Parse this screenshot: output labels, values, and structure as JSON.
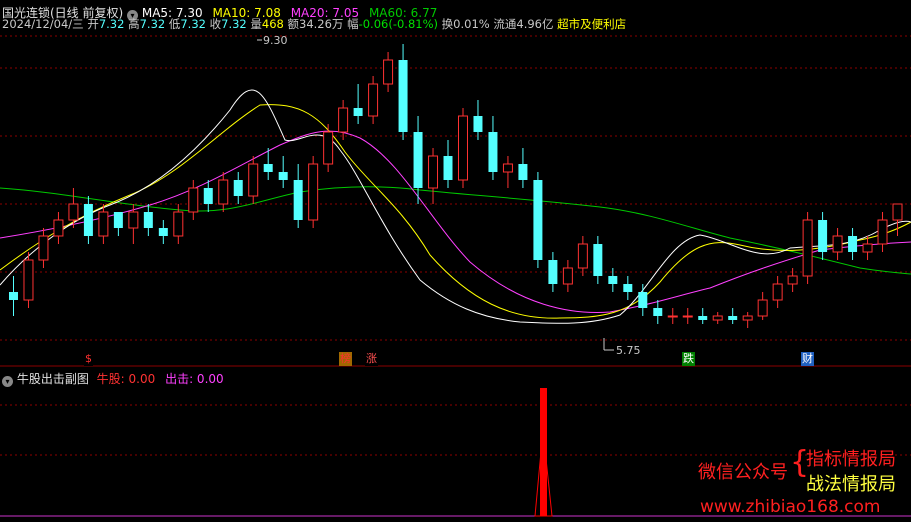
{
  "colors": {
    "up": "#ff3232",
    "down": "#54ffff",
    "ma5": "#ffffff",
    "ma10": "#ffff00",
    "ma20": "#ff40ff",
    "ma60": "#00c800",
    "grid": "#8b0000",
    "text": "#c8c8c8",
    "watermark": "#ff2020"
  },
  "header": {
    "title": "国光连锁(日线 前复权)",
    "ma5": "MA5: 7.30",
    "ma10": "MA10: 7.08",
    "ma20": "MA20: 7.05",
    "ma60": "MA60: 6.77"
  },
  "info": {
    "date": "2024/12/04/三",
    "open_label": "开",
    "open": "7.32",
    "high_label": "高",
    "high": "7.32",
    "low_label": "低",
    "low": "7.32",
    "close_label": "收",
    "close": "7.32",
    "vol_label": "量",
    "vol": "468",
    "amt_label": "额",
    "amt": "34.26万",
    "chg_label": "幅",
    "chg": "-0.06(-0.81%)",
    "turnover": "换0.01%",
    "float": "流通4.96亿",
    "sector": "超市及便利店"
  },
  "annotations": {
    "high_price": "9.30",
    "low_price": "5.75"
  },
  "event_tags": [
    {
      "label": "$",
      "color": "#ff3030",
      "bg": "#000"
    },
    {
      "label": "榜",
      "color": "#ff3030",
      "bg": "#a06800"
    },
    {
      "label": "涨",
      "color": "#ff5050",
      "bg": "#000"
    },
    {
      "label": "跌",
      "color": "#ffffff",
      "bg": "#008000"
    },
    {
      "label": "财",
      "color": "#ffffff",
      "bg": "#2060c0"
    }
  ],
  "sub": {
    "title": "牛股出击副图",
    "label1": "牛股: 0.00",
    "label2": "出击: 0.00"
  },
  "watermark": {
    "line1": "微信公众号",
    "line2a": "指标情报局",
    "line2b": "战法情报局",
    "url": "www.zhibiao168.com"
  },
  "chart_data": {
    "type": "candlestick",
    "y_high_marker": 9.3,
    "y_low_marker": 5.75,
    "last": {
      "open": 7.32,
      "high": 7.32,
      "low": 7.32,
      "close": 7.32,
      "volume": 468
    },
    "ma": {
      "MA5": 7.3,
      "MA10": 7.08,
      "MA20": 7.05,
      "MA60": 6.77
    },
    "ohlc": [
      [
        6.2,
        6.4,
        5.9,
        6.1
      ],
      [
        6.1,
        6.7,
        6.0,
        6.6
      ],
      [
        6.6,
        7.0,
        6.5,
        6.9
      ],
      [
        6.9,
        7.2,
        6.8,
        7.1
      ],
      [
        7.1,
        7.5,
        7.0,
        7.3
      ],
      [
        7.3,
        7.4,
        6.8,
        6.9
      ],
      [
        6.9,
        7.3,
        6.8,
        7.2
      ],
      [
        7.2,
        7.2,
        6.9,
        7.0
      ],
      [
        7.0,
        7.3,
        6.8,
        7.2
      ],
      [
        7.2,
        7.3,
        6.9,
        7.0
      ],
      [
        7.0,
        7.1,
        6.8,
        6.9
      ],
      [
        6.9,
        7.3,
        6.8,
        7.2
      ],
      [
        7.2,
        7.6,
        7.1,
        7.5
      ],
      [
        7.5,
        7.6,
        7.2,
        7.3
      ],
      [
        7.3,
        7.7,
        7.2,
        7.6
      ],
      [
        7.6,
        7.7,
        7.3,
        7.4
      ],
      [
        7.4,
        7.9,
        7.3,
        7.8
      ],
      [
        7.8,
        8.0,
        7.6,
        7.7
      ],
      [
        7.7,
        7.9,
        7.5,
        7.6
      ],
      [
        7.6,
        7.8,
        7.0,
        7.1
      ],
      [
        7.1,
        7.9,
        7.0,
        7.8
      ],
      [
        7.8,
        8.3,
        7.7,
        8.2
      ],
      [
        8.2,
        8.6,
        8.1,
        8.5
      ],
      [
        8.5,
        8.8,
        8.3,
        8.4
      ],
      [
        8.4,
        8.9,
        8.3,
        8.8
      ],
      [
        8.8,
        9.2,
        8.7,
        9.1
      ],
      [
        9.1,
        9.3,
        8.1,
        8.2
      ],
      [
        8.2,
        8.4,
        7.3,
        7.5
      ],
      [
        7.5,
        8.0,
        7.3,
        7.9
      ],
      [
        7.9,
        8.1,
        7.5,
        7.6
      ],
      [
        7.6,
        8.5,
        7.5,
        8.4
      ],
      [
        8.4,
        8.6,
        8.1,
        8.2
      ],
      [
        8.2,
        8.4,
        7.6,
        7.7
      ],
      [
        7.7,
        7.9,
        7.5,
        7.8
      ],
      [
        7.8,
        8.0,
        7.5,
        7.6
      ],
      [
        7.6,
        7.7,
        6.5,
        6.6
      ],
      [
        6.6,
        6.7,
        6.2,
        6.3
      ],
      [
        6.3,
        6.6,
        6.2,
        6.5
      ],
      [
        6.5,
        6.9,
        6.4,
        6.8
      ],
      [
        6.8,
        6.9,
        6.3,
        6.4
      ],
      [
        6.4,
        6.5,
        6.2,
        6.3
      ],
      [
        6.3,
        6.4,
        6.1,
        6.2
      ],
      [
        6.2,
        6.3,
        5.9,
        6.0
      ],
      [
        6.0,
        6.1,
        5.8,
        5.9
      ],
      [
        5.9,
        6.0,
        5.8,
        5.9
      ],
      [
        5.9,
        6.0,
        5.8,
        5.9
      ],
      [
        5.9,
        6.0,
        5.8,
        5.85
      ],
      [
        5.85,
        5.95,
        5.8,
        5.9
      ],
      [
        5.9,
        6.0,
        5.8,
        5.85
      ],
      [
        5.85,
        5.95,
        5.75,
        5.9
      ],
      [
        5.9,
        6.2,
        5.85,
        6.1
      ],
      [
        6.1,
        6.4,
        6.0,
        6.3
      ],
      [
        6.3,
        6.5,
        6.2,
        6.4
      ],
      [
        6.4,
        7.2,
        6.3,
        7.1
      ],
      [
        7.1,
        7.2,
        6.6,
        6.7
      ],
      [
        6.7,
        7.0,
        6.6,
        6.9
      ],
      [
        6.9,
        7.0,
        6.6,
        6.7
      ],
      [
        6.7,
        6.9,
        6.6,
        6.8
      ],
      [
        6.8,
        7.2,
        6.7,
        7.1
      ],
      [
        7.1,
        7.3,
        6.9,
        7.3
      ]
    ]
  }
}
